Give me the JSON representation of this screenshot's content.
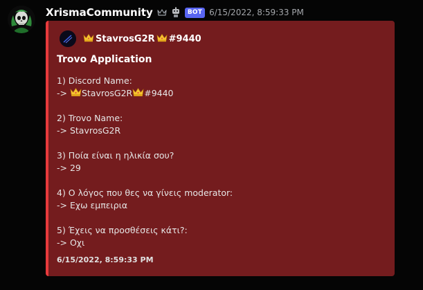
{
  "message": {
    "username": "XrismaCommunity",
    "bot_badge": "BOT",
    "timestamp": "6/15/2022, 8:59:33 PM",
    "icons": [
      "avatar-skull-icon",
      "crown-outline-icon",
      "robot-icon"
    ]
  },
  "embed": {
    "accent_color": "#e83a3c",
    "background_color": "#741c1e",
    "author": {
      "name_prefix": "",
      "name": "StavrosG2R",
      "name_suffix": "#9440",
      "icons": [
        "crown-emoji",
        "crown-emoji"
      ]
    },
    "title": "Trovo Application",
    "fields": [
      {
        "question": "1) Discord Name:",
        "answer_prefix": "-> ",
        "answer_name": "StavrosG2R",
        "answer_suffix": "#9440"
      },
      {
        "question": "2) Trovo Name:",
        "answer": "-> StavrosG2R"
      },
      {
        "question": "3) Ποία είναι η ηλικία σου?",
        "answer": "-> 29"
      },
      {
        "question": "4) Ο λόγος που θες να γίνεις moderator:",
        "answer": "-> Εχω εμπειρια"
      },
      {
        "question": "5) Έχεις να προσθέσεις κάτι?:",
        "answer": "-> Οχι"
      }
    ],
    "footer_timestamp": "6/15/2022, 8:59:33 PM"
  }
}
